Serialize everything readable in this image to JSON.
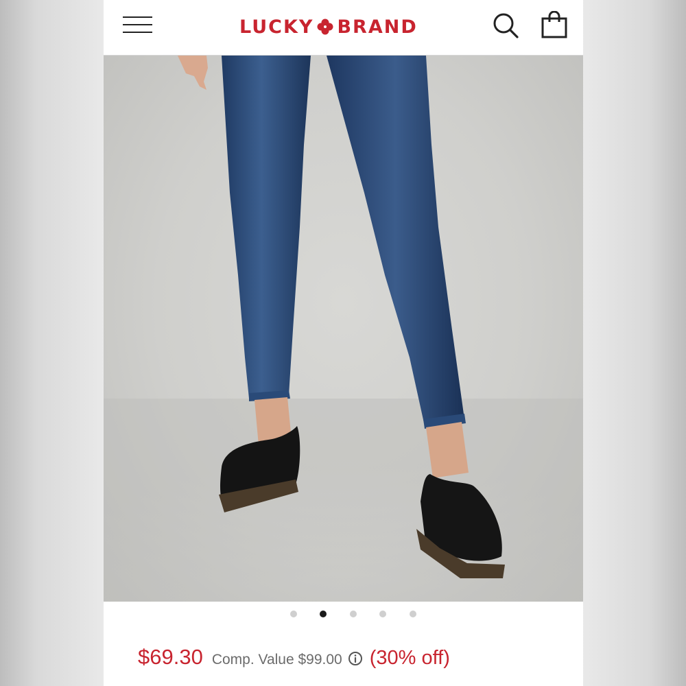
{
  "header": {
    "menu_icon": "hamburger-menu-icon",
    "logo_left": "LUCKY",
    "logo_right": "BRAND",
    "logo_mark": "clover-icon",
    "search_icon": "search-icon",
    "bag_icon": "shopping-bag-icon",
    "brand_color": "#c8242f"
  },
  "gallery": {
    "image_alt": "Model wearing dark-wash skinny jeans with black penny loafers",
    "total_slides": 5,
    "active_slide": 2
  },
  "pricing": {
    "price": "$69.30",
    "comp_value": "Comp. Value $99.00",
    "info_icon": "info-circle-icon",
    "discount": "(30% off)"
  }
}
